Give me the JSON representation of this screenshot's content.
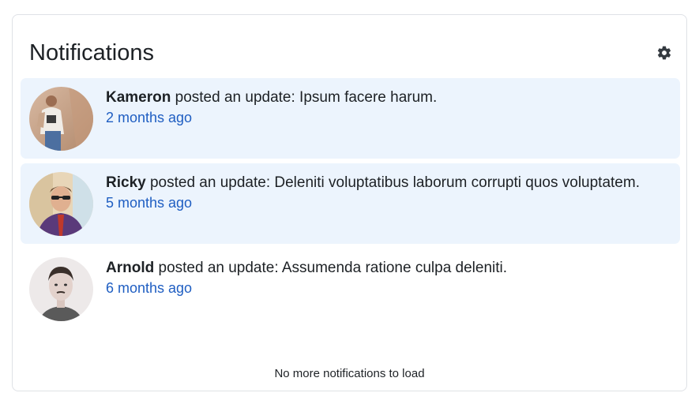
{
  "header": {
    "title": "Notifications",
    "settings_icon": "gear-icon"
  },
  "notifications": [
    {
      "name": "Kameron",
      "text": " posted an update: Ipsum facere harum.",
      "time": "2 months ago",
      "unread": true
    },
    {
      "name": "Ricky",
      "text": " posted an update: Deleniti voluptatibus laborum corrupti quos voluptatem.",
      "time": "5 months ago",
      "unread": true
    },
    {
      "name": "Arnold",
      "text": " posted an update: Assumenda ratione culpa deleniti.",
      "time": "6 months ago",
      "unread": false
    }
  ],
  "footer": {
    "text": "No more notifications to load"
  },
  "colors": {
    "unread_bg": "#ecf4fd",
    "link": "#1f5ec2",
    "border": "#dfe2e6"
  }
}
